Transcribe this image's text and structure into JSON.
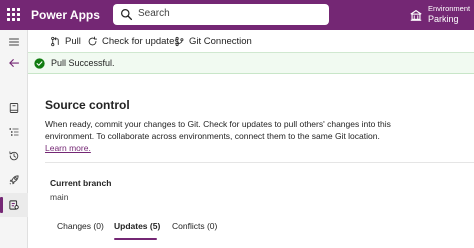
{
  "app": {
    "title": "Power Apps"
  },
  "search": {
    "placeholder": "Search"
  },
  "environment": {
    "label": "Environment",
    "name": "Parking"
  },
  "rail": {
    "icons": [
      "hamburger-icon",
      "back-arrow-icon",
      "book-icon",
      "tree-icon",
      "history-icon",
      "rocket-icon",
      "source-control-icon"
    ],
    "selected": "source-control-icon"
  },
  "toolbar": {
    "pull_label": "Pull",
    "check_label": "Check for updates",
    "git_label": "Git Connection"
  },
  "message": {
    "text": "Pull Successful.",
    "status": "success"
  },
  "source_control": {
    "title": "Source control",
    "description": "When ready, commit your changes to Git. Check for updates to pull others' changes into this environment. To collaborate across environments, connect them to the same Git location.",
    "learn_more": "Learn more."
  },
  "branch": {
    "label": "Current branch",
    "value": "main"
  },
  "tabs": [
    {
      "label": "Changes (0)",
      "selected": false
    },
    {
      "label": "Updates (5)",
      "selected": true
    },
    {
      "label": "Conflicts (0)",
      "selected": false
    }
  ],
  "colors": {
    "brand": "#742774",
    "success": "#107c10",
    "success_bg": "#f1faf1"
  }
}
